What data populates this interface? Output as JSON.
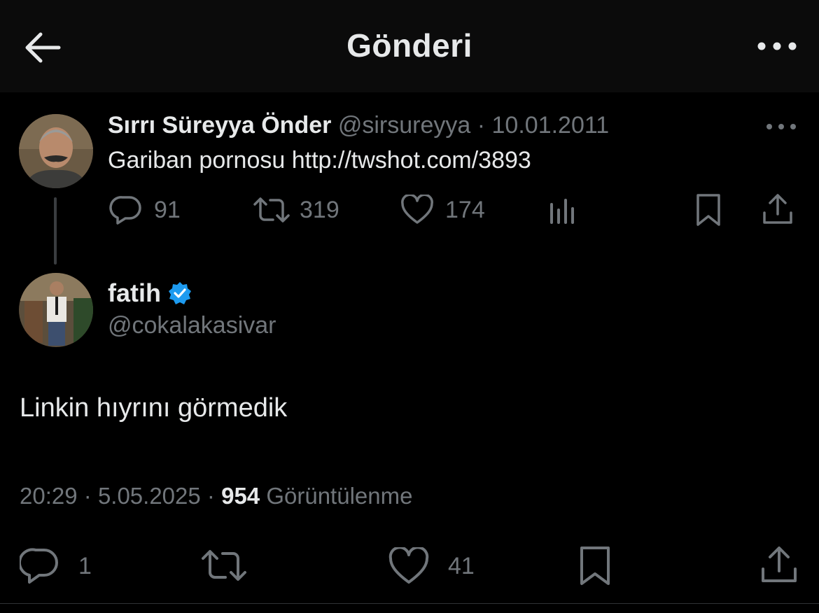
{
  "header": {
    "title": "Gönderi",
    "back_icon": "arrow-left-icon",
    "more_icon": "more-horizontal-icon"
  },
  "parent_tweet": {
    "author_name": "Sırrı Süreyya Önder",
    "handle": "@sirsureyya",
    "separator": "·",
    "date": "10.01.2011",
    "text": "Gariban pornosu http://twshot.com/3893",
    "replies": "91",
    "retweets": "319",
    "likes": "174"
  },
  "main_tweet": {
    "author_name": "fatih",
    "verified": true,
    "handle": "@cokalakasivar",
    "text": "Linkin hıyrını görmedik",
    "time": "20:29",
    "separator1": "·",
    "date": "5.05.2025",
    "separator2": "·",
    "views_count": "954",
    "views_label": "Görüntülenme",
    "replies": "1",
    "likes": "41"
  },
  "colors": {
    "background": "#000000",
    "header_bg": "#0b0b0b",
    "text": "#e7e9ea",
    "muted": "#71767b",
    "verified": "#1d9bf0"
  }
}
